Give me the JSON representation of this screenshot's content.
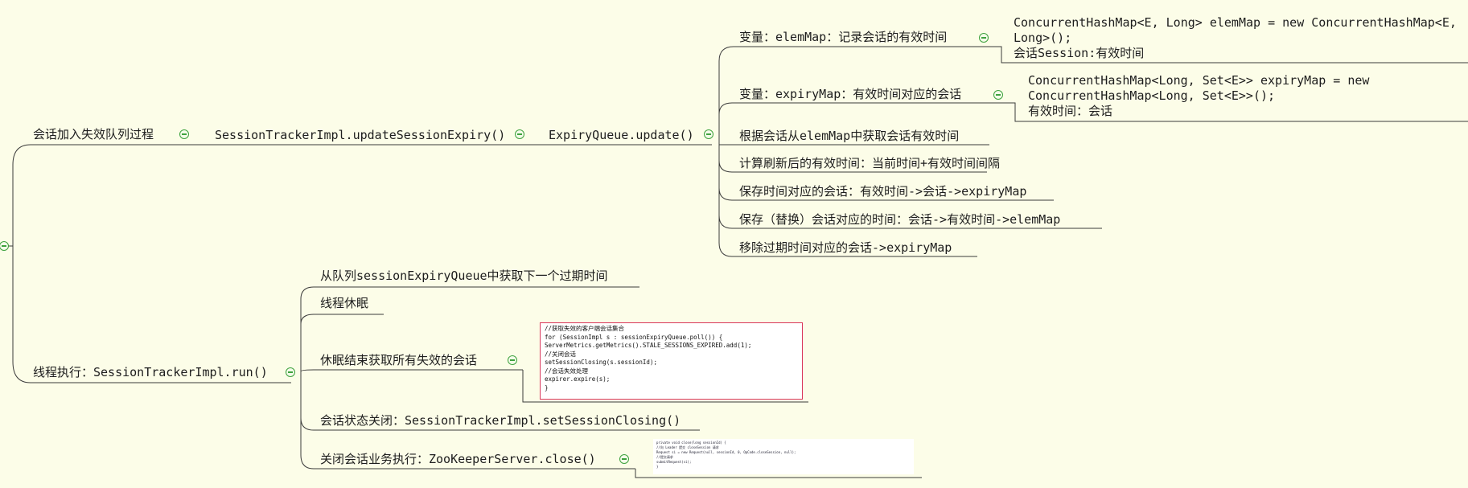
{
  "root": {
    "branch1": {
      "label": "会话加入失效队列过程",
      "method": "SessionTrackerImpl.updateSessionExpiry()",
      "queue": "ExpiryQueue.update()",
      "var1": {
        "label": "变量：elemMap：记录会话的有效时间",
        "detail": [
          "ConcurrentHashMap<E, Long> elemMap = new ConcurrentHashMap<E,",
          "Long>();",
          "会话Session:有效时间"
        ]
      },
      "var2": {
        "label": "变量：expiryMap：有效时间对应的会话",
        "detail": [
          "ConcurrentHashMap<Long, Set<E>> expiryMap = new",
          "ConcurrentHashMap<Long, Set<E>>();",
          "有效时间：会话"
        ]
      },
      "steps": [
        "根据会话从elemMap中获取会话有效时间",
        "计算刷新后的有效时间：当前时间+有效时间间隔",
        "保存时间对应的会话：有效时间->会话->expiryMap",
        "保存（替换）会话对应的时间：会话->有效时间->elemMap",
        "移除过期时间对应的会话->expiryMap"
      ]
    },
    "branch2": {
      "label": "线程执行：SessionTrackerImpl.run()",
      "steps": [
        "从队列sessionExpiryQueue中获取下一个过期时间",
        "线程休眠",
        "休眠结束获取所有失效的会话",
        "会话状态关闭：SessionTrackerImpl.setSessionClosing()",
        "关闭会话业务执行：ZooKeeperServer.close()"
      ],
      "snippet1": [
        "//获取失效的客户端会话集合",
        "for (SessionImpl s : sessionExpiryQueue.poll()) {",
        "    ServerMetrics.getMetrics().STALE_SESSIONS_EXPIRED.add(1);",
        "    //关闭会话",
        "    setSessionClosing(s.sessionId);",
        "    //会话失效处理",
        "    expirer.expire(s);",
        "}"
      ],
      "snippet2": [
        "private void close(long sessionId) {",
        "    //向 Leader 提交 closeSession 请求",
        "    Request si = new Request(null, sessionId, 0, OpCode.closeSession, null);",
        "    //提交请求",
        "    submitRequest(si);",
        "}"
      ]
    }
  },
  "colors": {
    "line": "#3a3a3a",
    "toggle": "#3ea23e",
    "snippet_border": "#d9365a",
    "background": "#fcfde8"
  }
}
